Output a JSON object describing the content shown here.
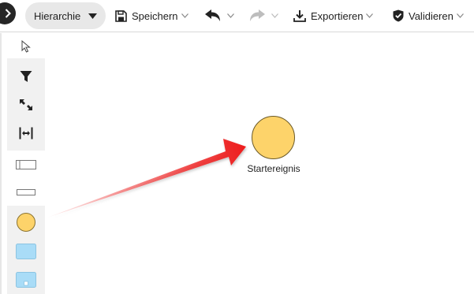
{
  "toolbar": {
    "hierarchy_label": "Hierarchie",
    "save_label": "Speichern",
    "export_label": "Exportieren",
    "validate_label": "Validieren"
  },
  "sidebar": {
    "tools": [
      "pointer-icon",
      "filter-icon",
      "resize-icon",
      "distribute-horizontal-icon",
      "lane-shape-icon",
      "thin-shape-icon",
      "event-circle-icon",
      "task-rect-icon",
      "subprocess-rect-icon"
    ]
  },
  "canvas": {
    "start_event_label": "Startereignis"
  },
  "colors": {
    "event_fill": "#fdd36a",
    "task_fill": "#a9dcf7",
    "arrow": "#ee1c1c"
  }
}
